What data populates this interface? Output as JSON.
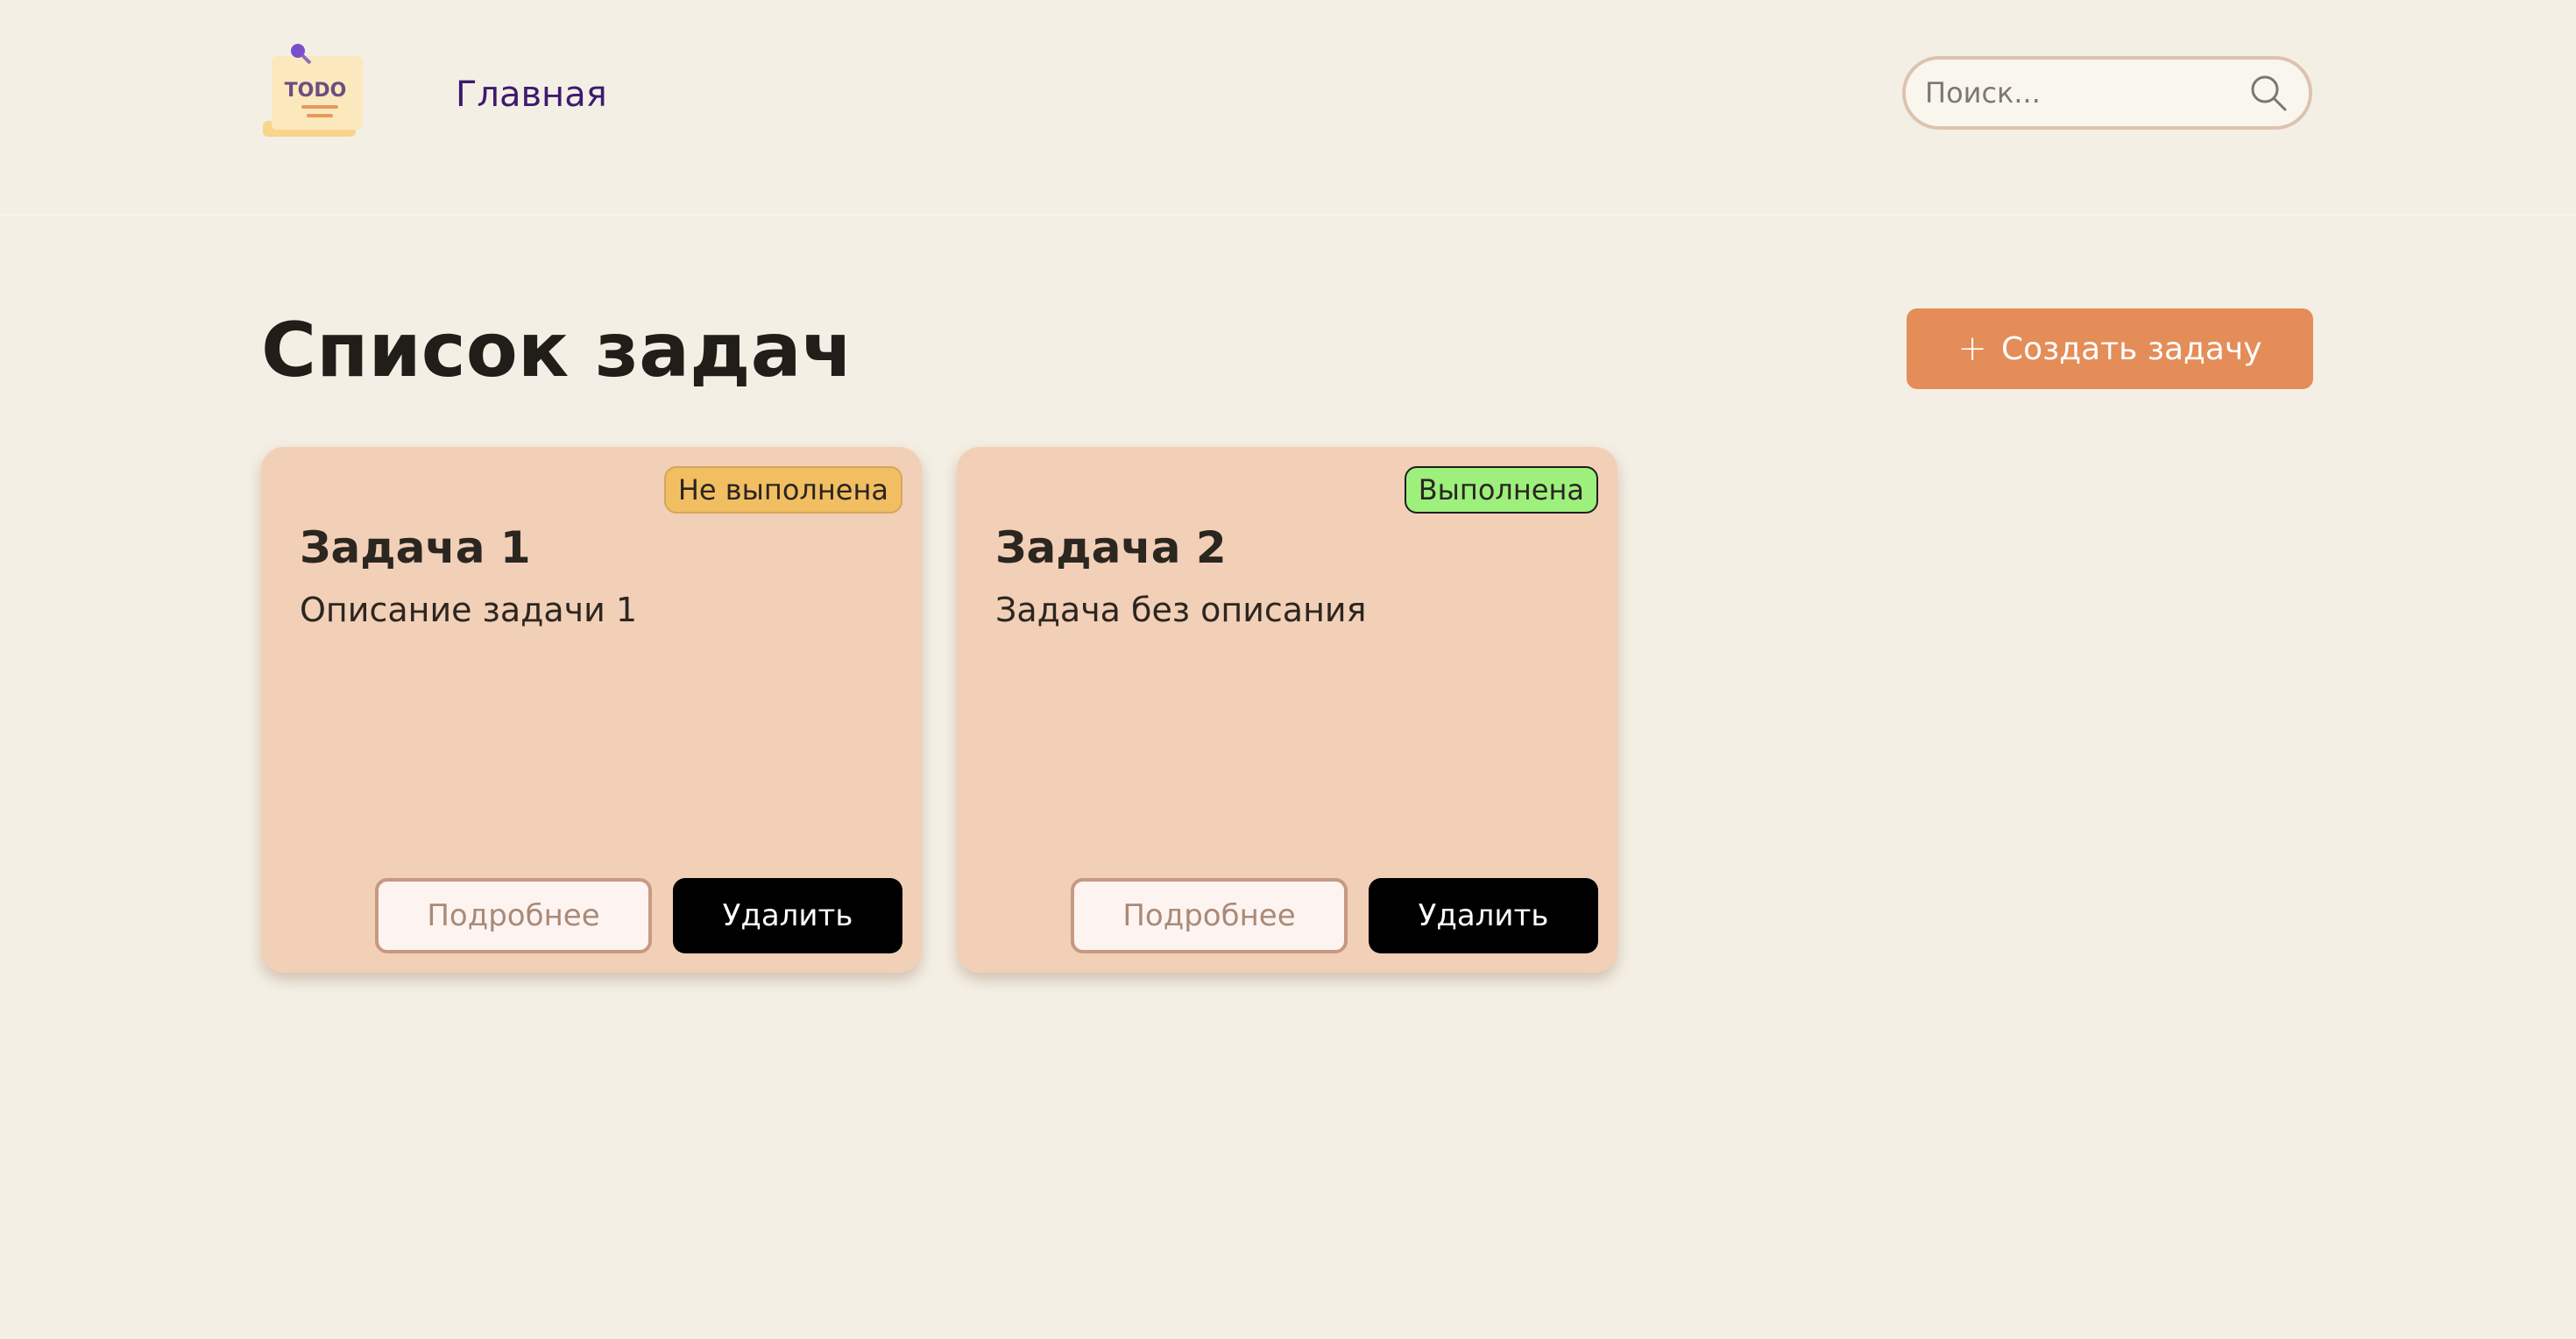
{
  "header": {
    "logo_text": "TODO",
    "nav_home": "Главная",
    "search_placeholder": "Поиск..."
  },
  "main": {
    "title": "Список задач",
    "create_button": {
      "icon": "+",
      "label": "Создать задачу"
    },
    "tasks": [
      {
        "status": "Не выполнена",
        "status_color": "#f2be62",
        "title": "Задача 1",
        "description": "Описание задачи 1",
        "details_label": "Подробнее",
        "delete_label": "Удалить"
      },
      {
        "status": "Выполнена",
        "status_color": "#9ef07c",
        "title": "Задача 2",
        "description": "Задача без описания",
        "details_label": "Подробнее",
        "delete_label": "Удалить"
      }
    ]
  },
  "colors": {
    "background": "#f4efe4",
    "card": "#f2cfb7",
    "accent": "#e48d58",
    "nav_link": "#3d1a6e"
  }
}
